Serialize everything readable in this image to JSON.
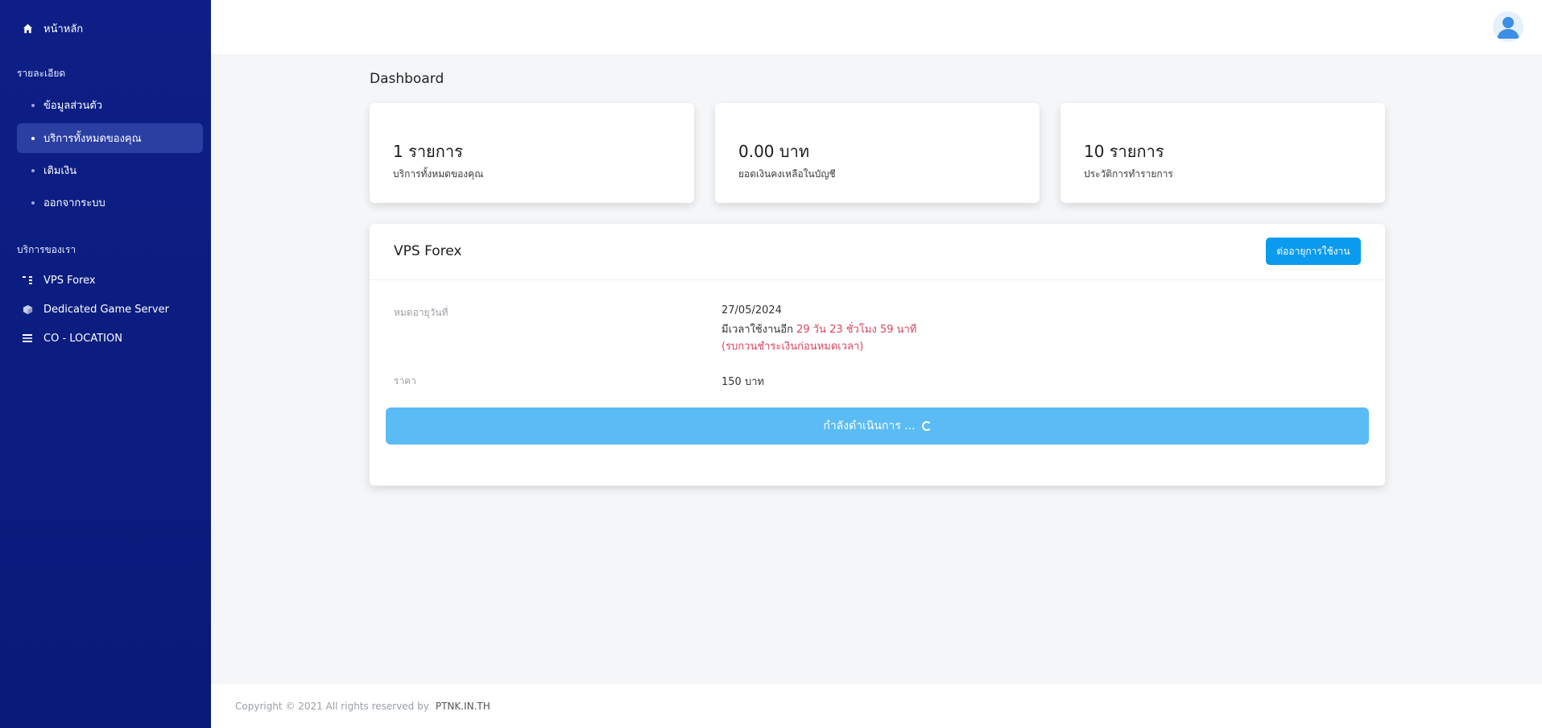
{
  "sidebar": {
    "home_label": "หน้าหลัก",
    "section_details": "รายละเอียด",
    "details_items": [
      {
        "label": "ข้อมูลส่วนตัว"
      },
      {
        "label": "บริการทั้งหมดของคุณ"
      },
      {
        "label": "เติมเงิน"
      },
      {
        "label": "ออกจากระบบ"
      }
    ],
    "section_services": "บริการของเรา",
    "services": [
      {
        "label": "VPS Forex",
        "icon": "vps-icon"
      },
      {
        "label": "Dedicated Game Server",
        "icon": "cube-icon"
      },
      {
        "label": "CO - LOCATION",
        "icon": "server-icon"
      }
    ]
  },
  "header": {
    "avatar_icon": "user-avatar-icon"
  },
  "page": {
    "title": "Dashboard"
  },
  "stats": [
    {
      "value": "1 รายการ",
      "label": "บริการทั้งหมดของคุณ"
    },
    {
      "value": "0.00 บาท",
      "label": "ยอดเงินคงเหลือในบัญชี"
    },
    {
      "value": "10 รายการ",
      "label": "ประวัติการทำรายการ"
    }
  ],
  "service": {
    "title": "VPS Forex",
    "renew_label": "ต่ออายุการใช้งาน",
    "expire_label": "หมดอายุวันที่",
    "expire_date": "27/05/2024",
    "remaining_prefix": "มีเวลาใช้งานอีก",
    "remaining_time": "29 วัน 23 ชั่วโมง 59 นาที",
    "warning": "(รบกวนชำระเงินก่อนหมดเวลา)",
    "price_label": "ราคา",
    "price_value": "150 บาท",
    "progress_label": "กำลังดำเนินการ ..."
  },
  "footer": {
    "copyright": "Copyright © 2021 All rights reserved by",
    "brand": "PTNK.IN.TH"
  },
  "colors": {
    "sidebar": "#0d1f86",
    "accent": "#0a9bef",
    "progress": "#5bbcf5",
    "warning": "#d9455f"
  }
}
